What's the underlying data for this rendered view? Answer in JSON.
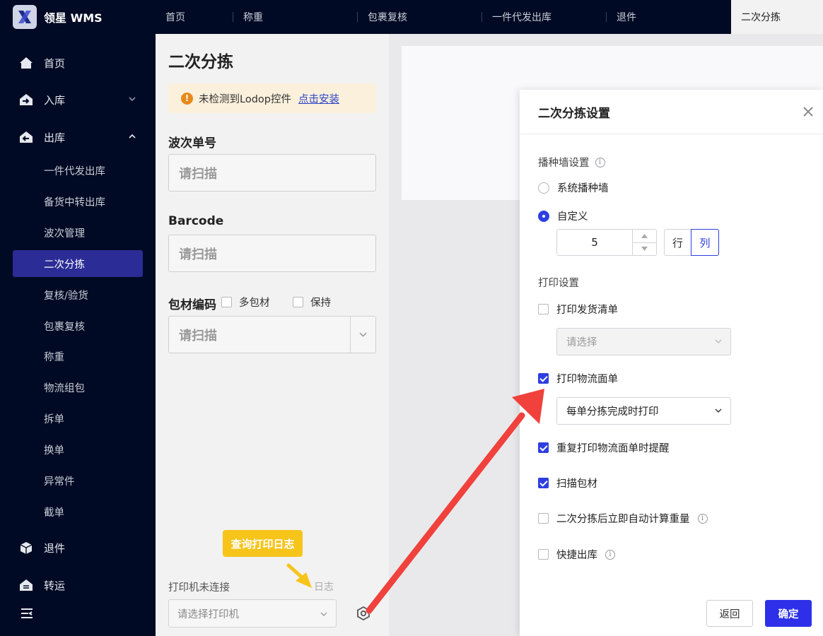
{
  "app": {
    "logo_text": "领星 WMS"
  },
  "tabs": [
    {
      "label": "首页"
    },
    {
      "label": "称重"
    },
    {
      "label": "包裹复核"
    },
    {
      "label": "一件代发出库"
    },
    {
      "label": "退件"
    },
    {
      "label": "二次分拣"
    }
  ],
  "sidebar": {
    "home": "首页",
    "inbound": "入库",
    "outbound": "出库",
    "sub_items": [
      "一件代发出库",
      "备货中转出库",
      "波次管理",
      "二次分拣",
      "复核/验货",
      "包裹复核",
      "称重",
      "物流组包",
      "拆单",
      "换单",
      "异常件",
      "截单"
    ],
    "returns": "退件",
    "transfer": "转运"
  },
  "page": {
    "title": "二次分拣",
    "alert_text": "未检测到Lodop控件",
    "alert_link": "点击安装",
    "wave_label": "波次单号",
    "wave_placeholder": "请扫描",
    "barcode_label": "Barcode",
    "barcode_placeholder": "请扫描",
    "pack_label": "包材编码",
    "multi_pack": "多包材",
    "keep": "保持",
    "pack_placeholder": "请扫描",
    "printer_status": "打印机未连接",
    "log_link": "日志",
    "printer_placeholder": "请选择打印机",
    "tooltip": "查询打印日志"
  },
  "modal": {
    "title": "二次分拣设置",
    "wall_section": "播种墙设置",
    "radio_system": "系统播种墙",
    "radio_custom": "自定义",
    "stepper_value": "5",
    "seg_row": "行",
    "seg_col": "列",
    "print_section": "打印设置",
    "print_packing_list": "打印发货清单",
    "packing_list_placeholder": "请选择",
    "print_logistics": "打印物流面单",
    "logistics_option": "每单分拣完成时打印",
    "repeat_remind": "重复打印物流面单时提醒",
    "scan_packing": "扫描包材",
    "auto_weight": "二次分拣后立即自动计算重量",
    "quick_outbound": "快捷出库",
    "back": "返回",
    "confirm": "确定"
  },
  "colors": {
    "accent": "#2d3fe0",
    "sidebar_bg": "#000a24",
    "tooltip": "#f7c41a",
    "arrow": "#f0413c"
  }
}
